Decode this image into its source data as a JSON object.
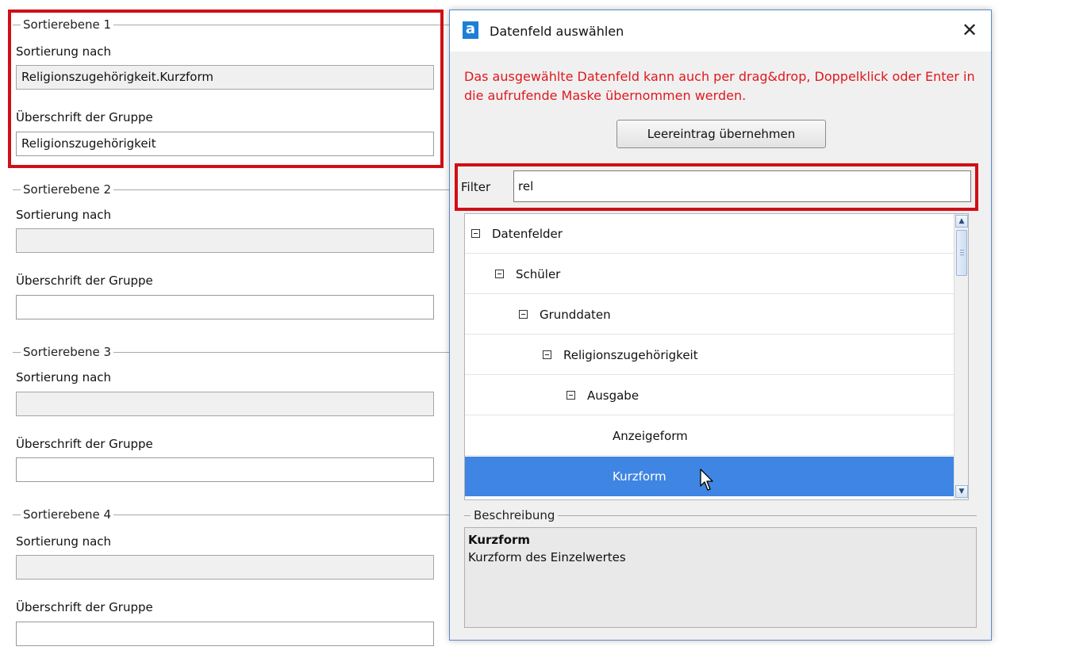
{
  "levels": [
    {
      "legend": "Sortierebene 1",
      "sort_label": "Sortierung nach",
      "sort_value": "Religionszugehörigkeit.Kurzform",
      "heading_label": "Überschrift der Gruppe",
      "heading_value": "Religionszugehörigkeit"
    },
    {
      "legend": "Sortierebene 2",
      "sort_label": "Sortierung nach",
      "sort_value": "",
      "heading_label": "Überschrift der Gruppe",
      "heading_value": ""
    },
    {
      "legend": "Sortierebene 3",
      "sort_label": "Sortierung nach",
      "sort_value": "",
      "heading_label": "Überschrift der Gruppe",
      "heading_value": ""
    },
    {
      "legend": "Sortierebene 4",
      "sort_label": "Sortierung nach",
      "sort_value": "",
      "heading_label": "Überschrift der Gruppe",
      "heading_value": ""
    }
  ],
  "dialog": {
    "title": "Datenfeld auswählen",
    "app_icon_letter": "a",
    "close_glyph": "✕",
    "hint": "Das ausgewählte Datenfeld kann auch per drag&drop, Doppelklick oder Enter in die aufrufende Maske übernommen werden.",
    "empty_entry_button": "Leereintrag übernehmen",
    "filter": {
      "label": "Filter",
      "value": "rel"
    },
    "tree": [
      {
        "label": "Datenfelder",
        "expandable": true,
        "expanded": true,
        "selected": false
      },
      {
        "label": "Schüler",
        "expandable": true,
        "expanded": true,
        "selected": false
      },
      {
        "label": "Grunddaten",
        "expandable": true,
        "expanded": true,
        "selected": false
      },
      {
        "label": "Religionszugehörigkeit",
        "expandable": true,
        "expanded": true,
        "selected": false
      },
      {
        "label": "Ausgabe",
        "expandable": true,
        "expanded": true,
        "selected": false
      },
      {
        "label": "Anzeigeform",
        "expandable": false,
        "selected": false
      },
      {
        "label": "Kurzform",
        "expandable": false,
        "selected": true
      }
    ],
    "description": {
      "legend": "Beschreibung",
      "title": "Kurzform",
      "text": "Kurzform des Einzelwertes"
    }
  },
  "colors": {
    "highlight_border": "#d00f16",
    "hint_text": "#e0181f",
    "selection": "#3f85e3",
    "dialog_border": "#5d88c6"
  },
  "icons": [
    "app-icon",
    "close-icon",
    "tree-collapse-icon",
    "scroll-up-icon",
    "scroll-down-icon",
    "mouse-cursor-icon"
  ]
}
